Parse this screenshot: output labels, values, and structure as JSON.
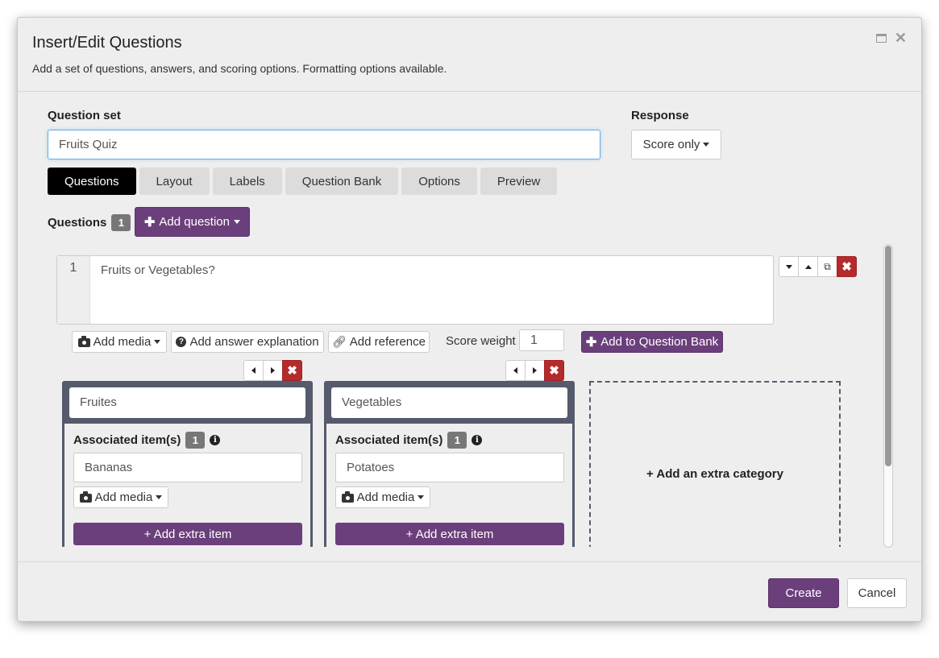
{
  "dialog": {
    "title": "Insert/Edit Questions",
    "subtitle": "Add a set of questions, answers, and scoring options. Formatting options available."
  },
  "question_set": {
    "label": "Question set",
    "value": "Fruits Quiz"
  },
  "response": {
    "label": "Response",
    "value": "Score only"
  },
  "tabs": [
    {
      "label": "Questions",
      "active": true
    },
    {
      "label": "Layout"
    },
    {
      "label": "Labels"
    },
    {
      "label": "Question Bank"
    },
    {
      "label": "Options"
    },
    {
      "label": "Preview"
    }
  ],
  "questions": {
    "label": "Questions",
    "count": "1",
    "add_label": "Add question"
  },
  "question": {
    "number": "1",
    "text": "Fruits or Vegetables?",
    "add_media": "Add media",
    "add_explanation": "Add answer explanation",
    "add_reference": "Add reference",
    "score_weight_label": "Score weight",
    "score_weight": "1",
    "add_to_bank": "Add to Question Bank"
  },
  "categories": [
    {
      "name": "Fruites",
      "assoc_label": "Associated item(s)",
      "assoc_count": "1",
      "item": "Bananas",
      "add_media": "Add media",
      "add_extra": "+ Add extra item"
    },
    {
      "name": "Vegetables",
      "assoc_label": "Associated item(s)",
      "assoc_count": "1",
      "item": "Potatoes",
      "add_media": "Add media",
      "add_extra": "+ Add extra item"
    }
  ],
  "extra_category": "+ Add an extra category",
  "footer": {
    "create": "Create",
    "cancel": "Cancel"
  },
  "colors": {
    "accent": "#6b3f7c",
    "danger": "#b52a2a",
    "category_header": "#555a6c"
  }
}
